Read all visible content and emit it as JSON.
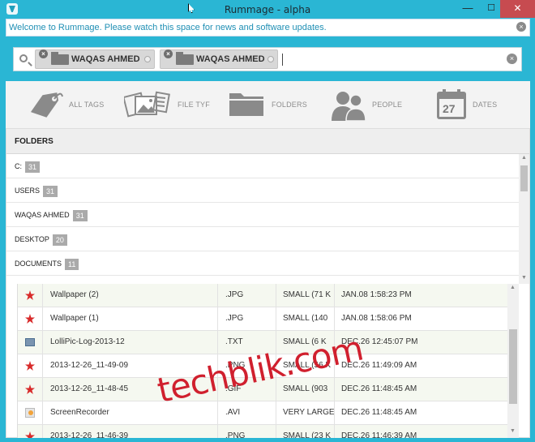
{
  "window": {
    "title": "Rummage - alpha",
    "minimize": "—",
    "maximize": "☐",
    "close": "✕"
  },
  "news": {
    "text": "Welcome to Rummage. Please watch this space for news and software updates.",
    "close": "×"
  },
  "search": {
    "tokens": [
      "WAQAS AHMED",
      "WAQAS AHMED"
    ],
    "clear": "×",
    "token_remove": "×"
  },
  "categories": [
    {
      "label": "ALL TAGS",
      "icon": "tag-icon"
    },
    {
      "label": "FILE TYF",
      "icon": "file-types-icon"
    },
    {
      "label": "FOLDERS",
      "icon": "folder-icon"
    },
    {
      "label": "PEOPLE",
      "icon": "people-icon"
    },
    {
      "label": "DATES",
      "icon": "calendar-icon",
      "calendar_day": "27"
    }
  ],
  "folders": {
    "title": "FOLDERS",
    "items": [
      {
        "name": "C:",
        "count": "31"
      },
      {
        "name": "USERS",
        "count": "31"
      },
      {
        "name": "WAQAS AHMED",
        "count": "31"
      },
      {
        "name": "DESKTOP",
        "count": "20"
      },
      {
        "name": "DOCUMENTS",
        "count": "11"
      }
    ]
  },
  "files": [
    {
      "icon": "image-red-icon",
      "name": "Wallpaper (2)",
      "type": ".JPG",
      "size": "SMALL (71 K",
      "date": "JAN.08 1:58:23 PM"
    },
    {
      "icon": "image-red-icon",
      "name": "Wallpaper (1)",
      "type": ".JPG",
      "size": "SMALL (140",
      "date": "JAN.08 1:58:06 PM"
    },
    {
      "icon": "text-file-icon",
      "name": "LolliPic-Log-2013-12",
      "type": ".TXT",
      "size": "SMALL (6 K",
      "date": "DEC.26 12:45:07 PM"
    },
    {
      "icon": "image-red-icon",
      "name": "2013-12-26_11-49-09",
      "type": ".PNG",
      "size": "SMALL (56 K",
      "date": "DEC.26 11:49:09 AM"
    },
    {
      "icon": "image-red-icon",
      "name": "2013-12-26_11-48-45",
      "type": ".GIF",
      "size": "SMALL (903",
      "date": "DEC.26 11:48:45 AM"
    },
    {
      "icon": "video-file-icon",
      "name": "ScreenRecorder",
      "type": ".AVI",
      "size": "VERY LARGE",
      "date": "DEC.26 11:48:45 AM"
    },
    {
      "icon": "image-red-icon",
      "name": "2013-12-26_11-46-39",
      "type": ".PNG",
      "size": "SMALL (23 K",
      "date": "DEC.26 11:46:39 AM"
    }
  ],
  "watermark": "techblik.com",
  "colors": {
    "accent": "#2ab6d4",
    "close_red": "#c74b50",
    "watermark_red": "#d0202e"
  }
}
